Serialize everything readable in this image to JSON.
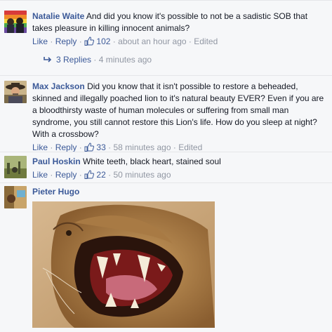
{
  "comments": [
    {
      "author": "Natalie Waite",
      "text": "And did you know it's possible to not be a sadistic SOB that takes pleasure in killing innocent animals?",
      "like_label": "Like",
      "reply_label": "Reply",
      "likes": "102",
      "time": "about an hour ago",
      "edited": "Edited",
      "replies_label": "3 Replies",
      "replies_time": "4 minutes ago"
    },
    {
      "author": "Max Jackson",
      "text": "Did you know that it isn't possible to restore a beheaded, skinned and illegally poached lion to it's natural beauty EVER? Even if you are a bloodthirsty waste of human molecules or suffering from small man syndrome, you still cannot restore this Lion's life. How do you sleep at night? With a crossbow?",
      "like_label": "Like",
      "reply_label": "Reply",
      "likes": "33",
      "time": "58 minutes ago",
      "edited": "Edited"
    },
    {
      "author": "Paul Hoskin",
      "text": "White teeth, black heart, stained soul",
      "like_label": "Like",
      "reply_label": "Reply",
      "likes": "22",
      "time": "50 minutes ago"
    },
    {
      "author": "Pieter Hugo"
    }
  ],
  "colors": {
    "link": "#3b5998",
    "meta": "#9197a3",
    "background": "#f6f7f9",
    "text": "#141823"
  },
  "icons": {
    "like": "thumbs-up-icon",
    "reply_arrow": "reply-arrow-icon"
  }
}
